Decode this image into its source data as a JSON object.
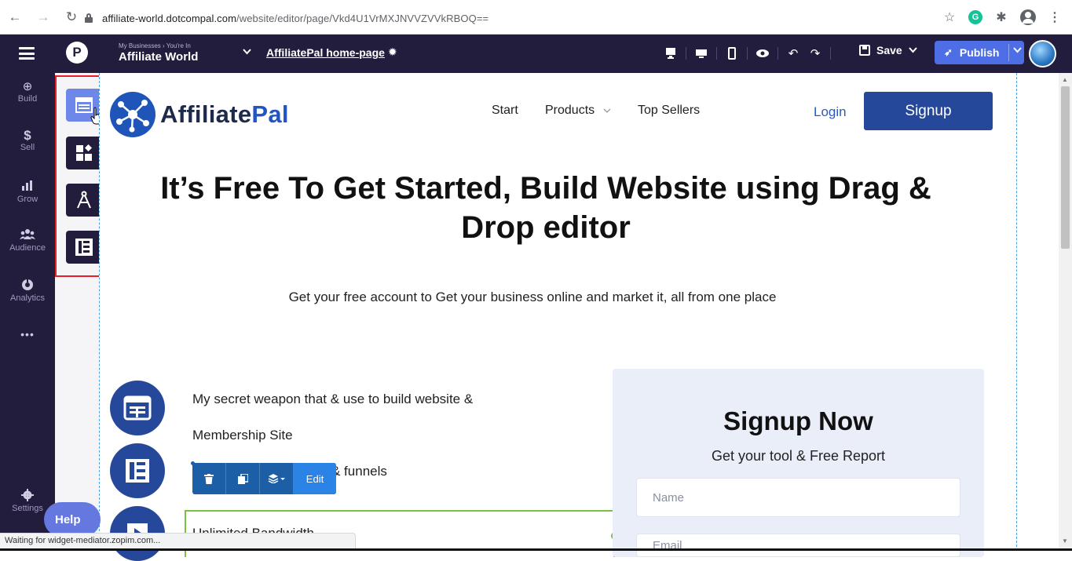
{
  "browser": {
    "url_main": "affiliate-world.dotcompal.com",
    "url_path": "/website/editor/page/Vkd4U1VrMXJNVVZVVkRBOQ=="
  },
  "topbar": {
    "breadcrumb": "My Businesses › You're In",
    "business_name": "Affiliate World",
    "page_name": "AffiliatePal home-page",
    "save_label": "Save",
    "publish_label": "Publish"
  },
  "sidebar": {
    "items": [
      {
        "label": "Build",
        "icon": "plus-circle-icon"
      },
      {
        "label": "Sell",
        "icon": "dollar-icon"
      },
      {
        "label": "Grow",
        "icon": "bar-chart-icon"
      },
      {
        "label": "Audience",
        "icon": "people-icon"
      },
      {
        "label": "Analytics",
        "icon": "pie-chart-icon"
      }
    ],
    "more": "•••",
    "settings_label": "Settings"
  },
  "widgets": [
    "sections-icon",
    "blocks-icon",
    "elements-icon",
    "layouts-icon"
  ],
  "site": {
    "brand_part1": "Affiliate",
    "brand_part2": "Pal",
    "nav": [
      "Start",
      "Products",
      "Top Sellers"
    ],
    "login": "Login",
    "signup": "Signup",
    "hero_line1": "It’s Free To Get Started, Build Website using Drag &",
    "hero_line2": "Drop editor",
    "hero_sub": "Get your free account to Get your business online and market it, all from one place",
    "feature1_a": "My secret weapon that & use to build website &",
    "feature1_b": "Membership Site",
    "feature2": "& funnels",
    "feature3": "Unlimited Bandwidth",
    "card_title": "Signup Now",
    "card_sub": "Get your tool & Free Report",
    "name_placeholder": "Name",
    "email_placeholder": "Email"
  },
  "element_toolbar": {
    "edit_label": "Edit"
  },
  "help_label": "Help",
  "status_text": "Waiting for widget-mediator.zopim.com...",
  "colors": {
    "app_dark": "#231d3d",
    "brand_blue": "#26489b",
    "accent": "#4e6ee6",
    "selection_green": "#7ac142"
  }
}
